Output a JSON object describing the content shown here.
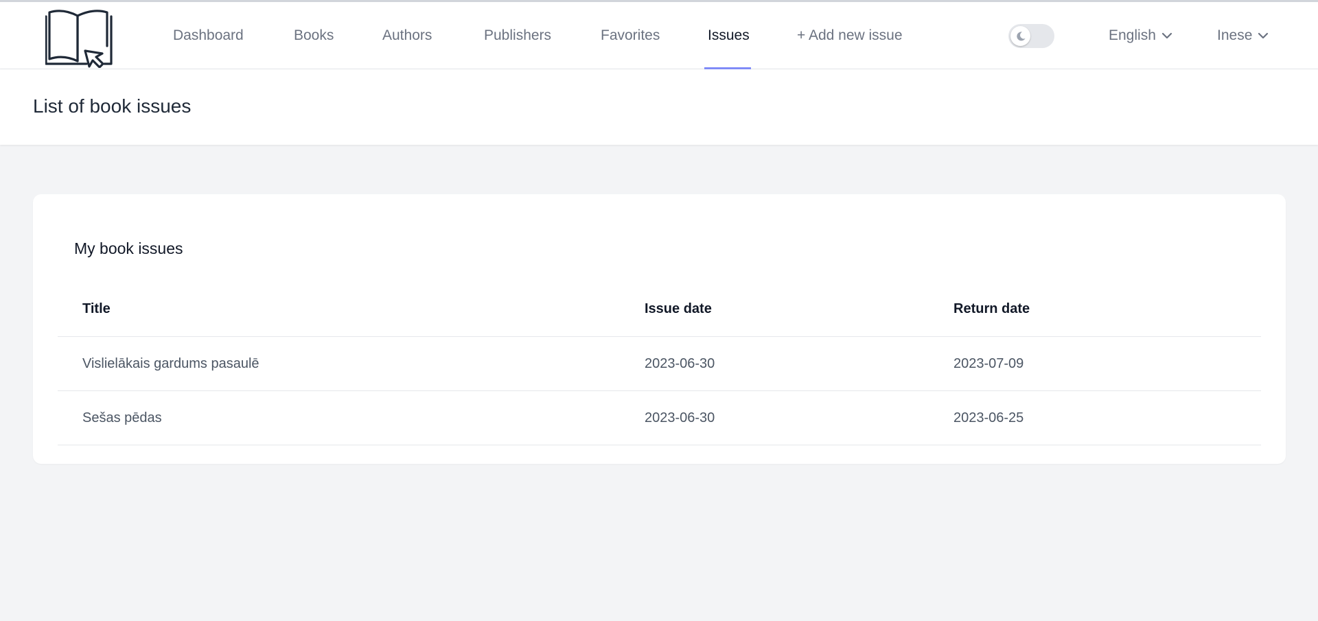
{
  "nav": {
    "links": [
      {
        "label": "Dashboard",
        "active": false
      },
      {
        "label": "Books",
        "active": false
      },
      {
        "label": "Authors",
        "active": false
      },
      {
        "label": "Publishers",
        "active": false
      },
      {
        "label": "Favorites",
        "active": false
      },
      {
        "label": "Issues",
        "active": true
      },
      {
        "label": "+ Add new issue",
        "active": false
      }
    ],
    "theme_toggle": {
      "icon": "moon-icon",
      "dark_mode": false
    },
    "language": {
      "label": "English",
      "icon": "chevron-down-icon"
    },
    "user": {
      "label": "Inese",
      "icon": "chevron-down-icon"
    },
    "logo_icon": "open-book-cursor-logo"
  },
  "header": {
    "title": "List of book issues"
  },
  "card": {
    "title": "My book issues",
    "columns": [
      "Title",
      "Issue date",
      "Return date"
    ],
    "rows": [
      {
        "title": "Vislielākais gardums pasaulē",
        "issue_date": "2023-06-30",
        "return_date": "2023-07-09"
      },
      {
        "title": "Sešas pēdas",
        "issue_date": "2023-06-30",
        "return_date": "2023-06-25"
      }
    ]
  },
  "colors": {
    "accent": "#818cf8",
    "page_background": "#f3f4f6",
    "text_muted": "#6b7280"
  }
}
